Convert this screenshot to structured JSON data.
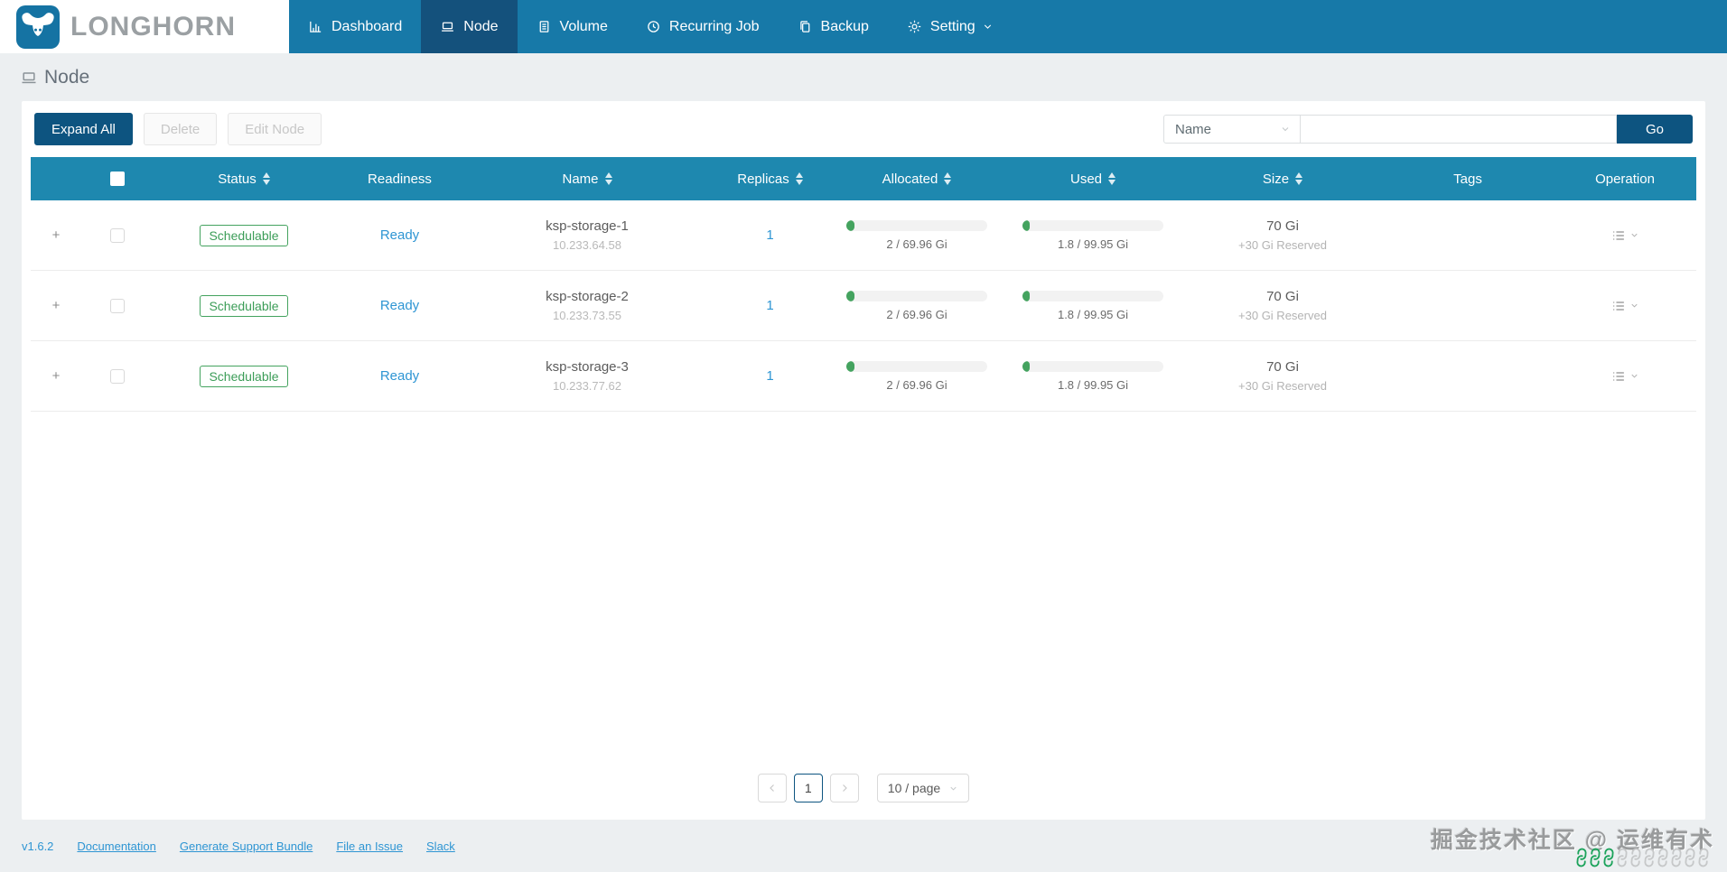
{
  "brand": {
    "name": "LONGHORN"
  },
  "nav": {
    "items": [
      {
        "label": "Dashboard",
        "icon": "dashboard-icon",
        "active": false,
        "has_dropdown": false
      },
      {
        "label": "Node",
        "icon": "node-icon",
        "active": true,
        "has_dropdown": false
      },
      {
        "label": "Volume",
        "icon": "volume-icon",
        "active": false,
        "has_dropdown": false
      },
      {
        "label": "Recurring Job",
        "icon": "recurring-job-icon",
        "active": false,
        "has_dropdown": false
      },
      {
        "label": "Backup",
        "icon": "backup-icon",
        "active": false,
        "has_dropdown": false
      },
      {
        "label": "Setting",
        "icon": "setting-icon",
        "active": false,
        "has_dropdown": true
      }
    ]
  },
  "page": {
    "title": "Node"
  },
  "toolbar": {
    "expand_all_label": "Expand All",
    "delete_label": "Delete",
    "edit_node_label": "Edit Node",
    "filter_selected": "Name",
    "search_value": "",
    "go_label": "Go"
  },
  "table": {
    "columns": [
      {
        "key": "status",
        "label": "Status",
        "sortable": true
      },
      {
        "key": "ready",
        "label": "Readiness",
        "sortable": false
      },
      {
        "key": "name",
        "label": "Name",
        "sortable": true
      },
      {
        "key": "replicas",
        "label": "Replicas",
        "sortable": true
      },
      {
        "key": "alloc",
        "label": "Allocated",
        "sortable": true
      },
      {
        "key": "used",
        "label": "Used",
        "sortable": true
      },
      {
        "key": "size",
        "label": "Size",
        "sortable": true
      },
      {
        "key": "tags",
        "label": "Tags",
        "sortable": false
      },
      {
        "key": "op",
        "label": "Operation",
        "sortable": false
      }
    ],
    "rows": [
      {
        "status": "Schedulable",
        "readiness": "Ready",
        "name": "ksp-storage-1",
        "ip": "10.233.64.58",
        "replicas": "1",
        "allocated_label": "2 / 69.96 Gi",
        "allocated_percent": 6,
        "used_label": "1.8 / 99.95 Gi",
        "used_percent": 5,
        "size": "70 Gi",
        "size_note": "+30 Gi Reserved",
        "tags": ""
      },
      {
        "status": "Schedulable",
        "readiness": "Ready",
        "name": "ksp-storage-2",
        "ip": "10.233.73.55",
        "replicas": "1",
        "allocated_label": "2 / 69.96 Gi",
        "allocated_percent": 6,
        "used_label": "1.8 / 99.95 Gi",
        "used_percent": 5,
        "size": "70 Gi",
        "size_note": "+30 Gi Reserved",
        "tags": ""
      },
      {
        "status": "Schedulable",
        "readiness": "Ready",
        "name": "ksp-storage-3",
        "ip": "10.233.77.62",
        "replicas": "1",
        "allocated_label": "2 / 69.96 Gi",
        "allocated_percent": 6,
        "used_label": "1.8 / 99.95 Gi",
        "used_percent": 5,
        "size": "70 Gi",
        "size_note": "+30 Gi Reserved",
        "tags": ""
      }
    ]
  },
  "pagination": {
    "current_page": "1",
    "page_size_label": "10 / page"
  },
  "footer": {
    "version": "v1.6.2",
    "links": [
      "Documentation",
      "Generate Support Bundle",
      "File an Issue",
      "Slack"
    ]
  },
  "watermark": {
    "text": "掘金技术社区 @ 运维有术",
    "green_links": 3,
    "gray_links": 7
  },
  "colors": {
    "navbar": "#1779A8",
    "navbar_active": "#14517C",
    "table_header": "#1E88AF",
    "primary_button": "#0D5480",
    "link": "#2E95D3",
    "green": "#44A35F",
    "page_bg": "#ECEFF1"
  }
}
